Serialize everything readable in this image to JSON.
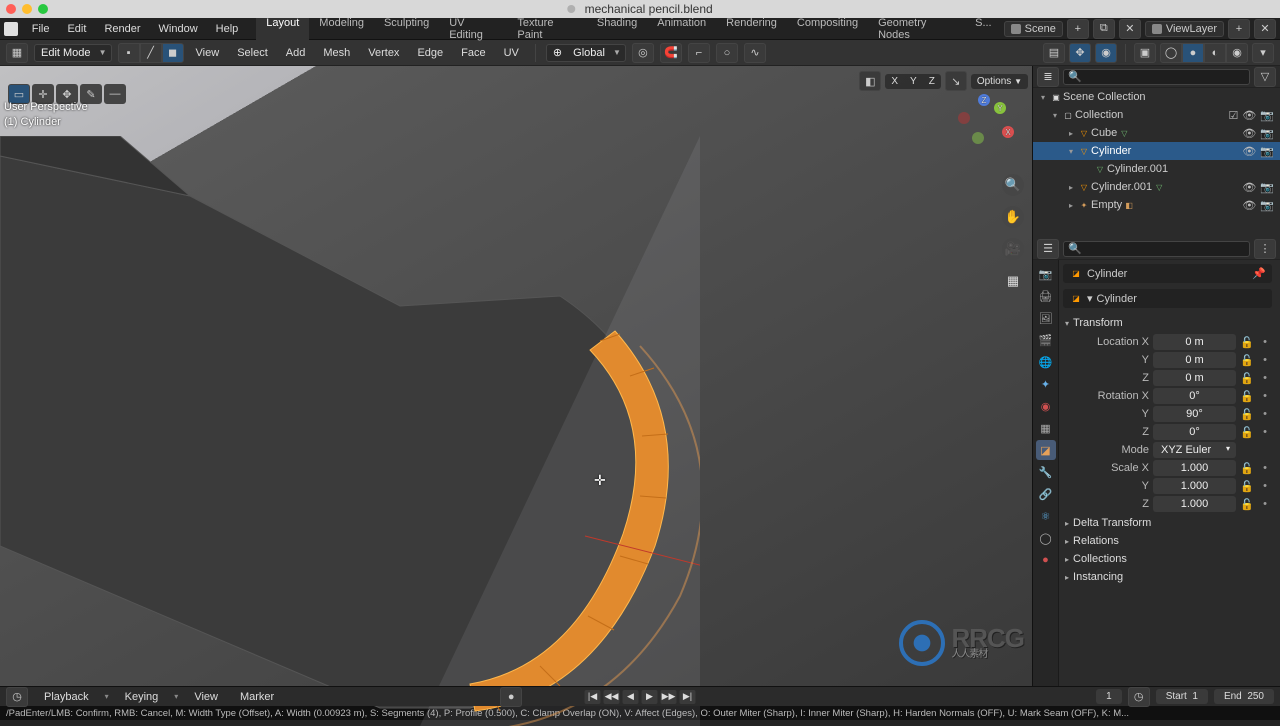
{
  "titlebar": {
    "filename": "mechanical pencil.blend"
  },
  "menu": [
    "File",
    "Edit",
    "Render",
    "Window",
    "Help"
  ],
  "workspaces": [
    "Layout",
    "Modeling",
    "Sculpting",
    "UV Editing",
    "Texture Paint",
    "Shading",
    "Animation",
    "Rendering",
    "Compositing",
    "Geometry Nodes",
    "S..."
  ],
  "active_workspace": 0,
  "scene_row": {
    "scene": "Scene",
    "viewlayer": "ViewLayer"
  },
  "toolbar": {
    "mode": "Edit Mode",
    "menus": [
      "View",
      "Select",
      "Add",
      "Mesh",
      "Vertex",
      "Edge",
      "Face",
      "UV"
    ],
    "orientation": "Global"
  },
  "overlay": {
    "options": "Options",
    "xyz": [
      "X",
      "Y",
      "Z"
    ],
    "hud_top": "User Perspective",
    "hud_obj": "(1) Cylinder"
  },
  "outliner": {
    "root": "Scene Collection",
    "collection": "Collection",
    "items": [
      {
        "name": "Cube",
        "type": "mesh"
      },
      {
        "name": "Cylinder",
        "type": "mesh",
        "sel": true
      },
      {
        "name": "Cylinder.001",
        "type": "mesh",
        "child": true
      },
      {
        "name": "Cylinder.001",
        "type": "mesh"
      },
      {
        "name": "Empty",
        "type": "empty"
      }
    ]
  },
  "props": {
    "crumb_obj": "Cylinder",
    "crumb_obj2": "Cylinder",
    "transform_label": "Transform",
    "loc": {
      "label": "Location X",
      "x": "0 m",
      "y": "0 m",
      "z": "0 m"
    },
    "rot": {
      "label": "Rotation X",
      "x": "0°",
      "y": "90°",
      "z": "0°"
    },
    "mode_label": "Mode",
    "mode": "XYZ Euler",
    "scale": {
      "label": "Scale X",
      "x": "1.000",
      "y": "1.000",
      "z": "1.000"
    },
    "delta": "Delta Transform",
    "relations": "Relations",
    "collections": "Collections",
    "instancing": "Instancing"
  },
  "timeline": {
    "menus": [
      "Playback",
      "Keying",
      "View",
      "Marker"
    ],
    "frame_cur": "1",
    "start_label": "Start",
    "start": "1",
    "end_label": "End",
    "end": "250"
  },
  "status": "/PadEnter/LMB: Confirm, RMB: Cancel, M: Width Type (Offset), A: Width (0.00923 m), S: Segments (4), P: Profile (0.500), C: Clamp Overlap (ON), V: Affect (Edges), O: Outer Miter (Sharp), I: Inner Miter (Sharp), H: Harden Normals (OFF), U: Mark Seam (OFF), K: M...",
  "watermark": "RRCG"
}
